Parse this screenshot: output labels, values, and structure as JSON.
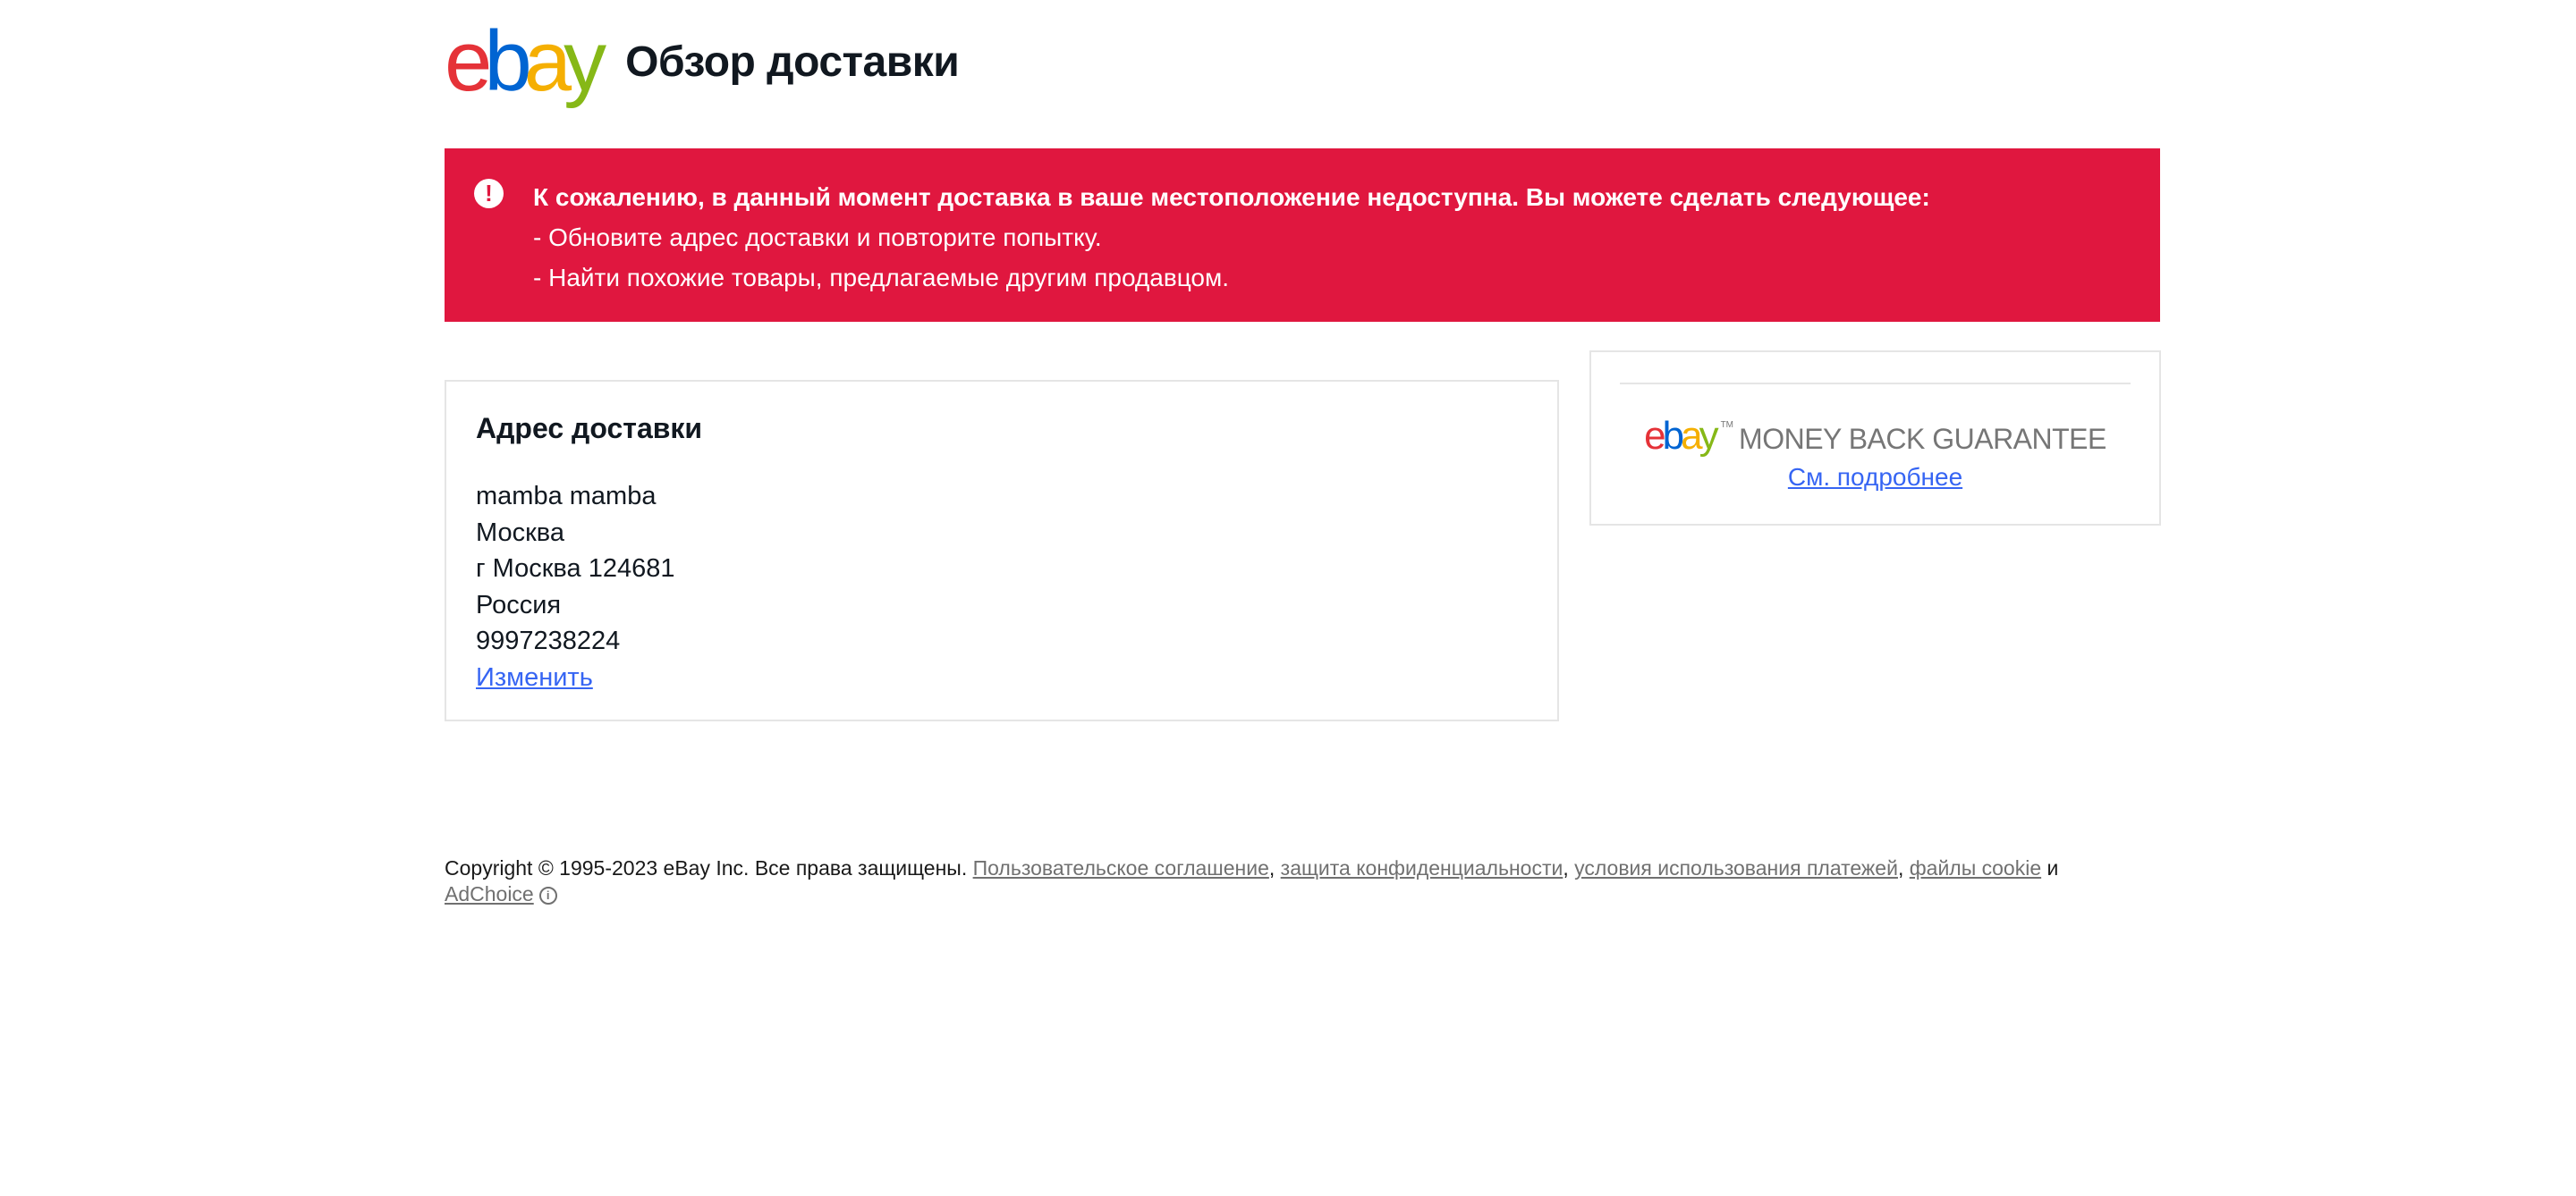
{
  "header": {
    "logo": {
      "e": "e",
      "b": "b",
      "a": "a",
      "y": "y"
    },
    "title": "Обзор доставки"
  },
  "alert": {
    "icon": "alert-exclamation-icon",
    "icon_glyph": "!",
    "lines": [
      "К сожалению, в данный момент доставка в ваше местоположение недоступна. Вы можете сделать следующее:",
      "- Обновите адрес доставки и повторите попытку.",
      "- Найти похожие товары, предлагаемые другим продавцом."
    ],
    "background": "#e0173f"
  },
  "address": {
    "heading": "Адрес доставки",
    "lines": [
      "mamba mamba",
      "Москва",
      "г Москва 124681",
      "Россия",
      "9997238224"
    ],
    "change_link": "Изменить"
  },
  "money_back": {
    "logo": {
      "e": "e",
      "b": "b",
      "a": "a",
      "y": "y"
    },
    "tm": "TM",
    "label": "MONEY BACK GUARANTEE",
    "details_link": "См. подробнее"
  },
  "footer": {
    "copyright": "Copyright © 1995-2023 eBay Inc. Все права защищены.",
    "links": [
      "Пользовательское соглашение",
      "защита конфиденциальности",
      "условия использования платежей",
      "файлы cookie"
    ],
    "and_word": "и",
    "adchoice": "AdChoice",
    "adchoice_icon": "info-icon"
  },
  "colors": {
    "link": "#3665f3",
    "alert": "#e0173f",
    "ebay_red": "#e53238",
    "ebay_blue": "#0064d2",
    "ebay_yellow": "#f5af02",
    "ebay_green": "#86b817"
  }
}
